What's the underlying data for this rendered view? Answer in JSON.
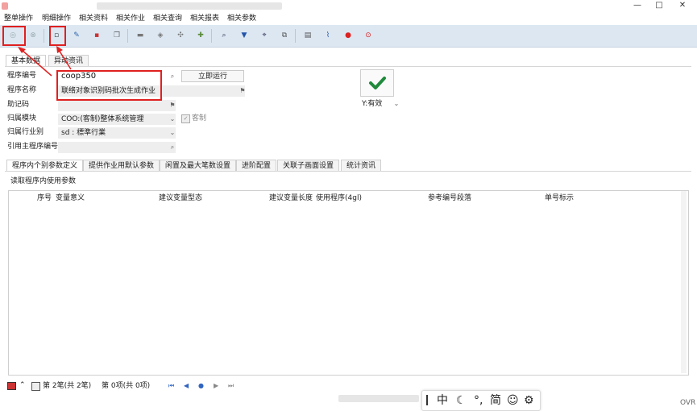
{
  "menu": [
    "整单操作",
    "明细操作",
    "相关资料",
    "相关作业",
    "相关查询",
    "相关报表",
    "相关参数"
  ],
  "window_controls": {
    "minimize": "—",
    "maximize": "□",
    "close": "✕"
  },
  "form_tabs": [
    "基本数据",
    "异动资讯"
  ],
  "fields": {
    "program_no_label": "程序编号",
    "program_no_value": "coop350",
    "program_name_label": "程序名称",
    "program_name_value": "联络对象识别码批次生成作业",
    "mnemonic_label": "助记码",
    "mnemonic_value": "",
    "module_label": "归属模块",
    "module_value": "COO:(客制)整体系统管理",
    "custom_label": "客制",
    "industry_label": "归属行业别",
    "industry_value": "sd : 標準行業",
    "main_program_label": "引用主程序编号",
    "main_program_value": ""
  },
  "run_now_label": "立即运行",
  "status_valid": "Y:有效",
  "detail_tabs": [
    "程序内个别参数定义",
    "提供作业用默认参数",
    "闲置及最大笔数设置",
    "进阶配置",
    "关联子画面设置",
    "统计资讯"
  ],
  "read_params_label": "读取程序内使用参数",
  "table_columns": [
    "序号",
    "变量意义",
    "建议变量型态",
    "建议变量长度",
    "使用程序(4gl)",
    "参考编号段落",
    "单号标示"
  ],
  "status_bar": {
    "record_text": "第 2笔(共 2笔)",
    "item_text": "第  0项(共  0项)",
    "mode": "OVR"
  },
  "ime": [
    "中",
    "简"
  ],
  "colors": {
    "toolbar_bg": "#dce7f2",
    "highlight": "#e02020",
    "check": "#1f8a3b"
  },
  "icons": [
    "confirm-icon",
    "cancel-icon",
    "new-icon",
    "edit-icon",
    "delete-icon",
    "copy-icon",
    "print-icon",
    "export-icon",
    "settings-icon",
    "attach-icon",
    "search-icon",
    "filter-icon",
    "query-icon",
    "link-icon",
    "doc-icon",
    "clip-icon",
    "location-icon",
    "help-icon",
    "check-icon"
  ]
}
